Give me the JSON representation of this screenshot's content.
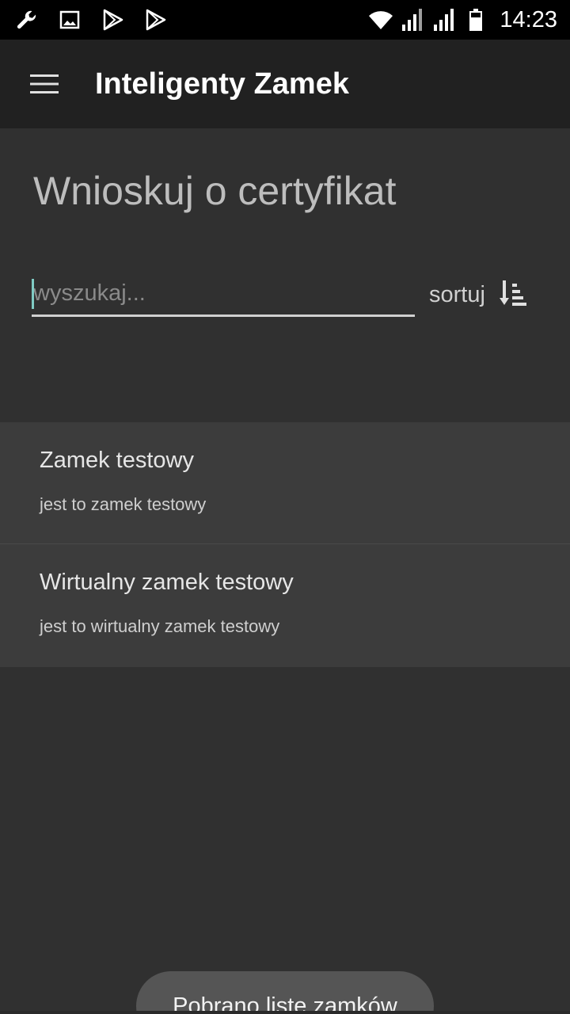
{
  "status_bar": {
    "time": "14:23",
    "left_icons": [
      "wrench-icon",
      "image-icon",
      "play-store-icon",
      "play-store-icon"
    ],
    "right_icons": [
      "wifi-icon",
      "signal-icon",
      "signal-icon",
      "battery-icon"
    ]
  },
  "app_bar": {
    "menu_icon": "hamburger-menu-icon",
    "title": "Inteligenty Zamek"
  },
  "page": {
    "title": "Wnioskuj o certyfikat"
  },
  "search": {
    "placeholder": "wyszukaj...",
    "value": ""
  },
  "sort": {
    "label": "sortuj",
    "icon": "sort-icon"
  },
  "locks": [
    {
      "name": "Zamek testowy",
      "description": "jest to zamek testowy"
    },
    {
      "name": "Wirtualny zamek testowy",
      "description": "jest to wirtualny zamek testowy"
    }
  ],
  "toast": {
    "message": "Pobrano listę zamków"
  },
  "colors": {
    "background": "#303030",
    "app_bar": "#212121",
    "list_item": "#3c3c3c",
    "accent_caret": "#80cbc4",
    "toast": "#555555"
  }
}
